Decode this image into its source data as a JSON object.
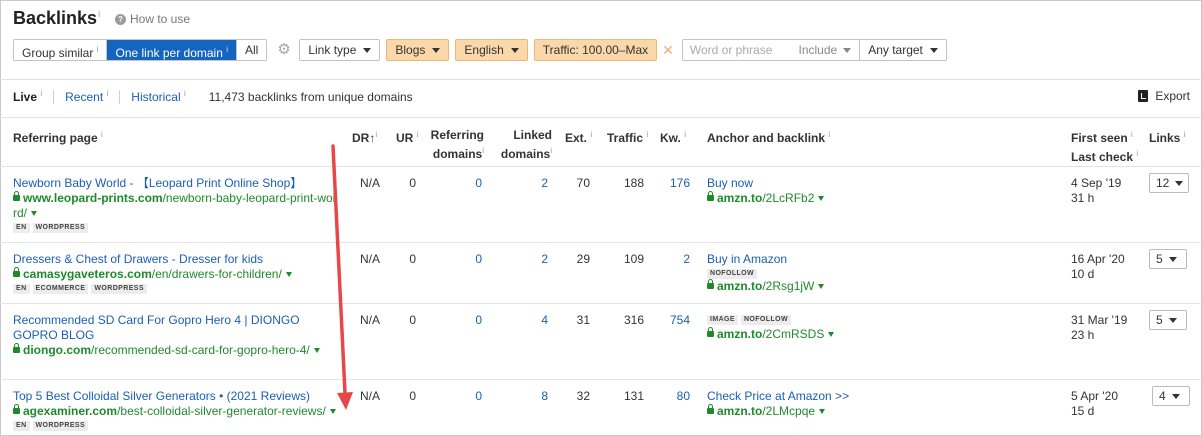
{
  "header": {
    "title": "Backlinks",
    "title_info": "i",
    "how_to_use": "How to use"
  },
  "toolbar": {
    "group_similar": "Group similar",
    "one_link_per_domain": "One link per domain",
    "all": "All",
    "info": "i",
    "link_type": "Link type",
    "blogs": "Blogs",
    "language": "English",
    "traffic": "Traffic: 100.00–Max",
    "search_placeholder": "Word or phrase",
    "include": "Include",
    "any_target": "Any target"
  },
  "tabs": {
    "live": "Live",
    "recent": "Recent",
    "historical": "Historical",
    "info": "i",
    "count": "11,473 backlinks from unique domains",
    "export": "Export"
  },
  "columns": {
    "referring_page": "Referring page",
    "dr": "DR",
    "dr_sort": "↑",
    "ur": "UR",
    "ref_domains_1": "Referring",
    "ref_domains_2": "domains",
    "linked_domains_1": "Linked",
    "linked_domains_2": "domains",
    "ext": "Ext.",
    "traffic": "Traffic",
    "kw": "Kw.",
    "anchor": "Anchor and backlink",
    "first_seen": "First seen",
    "last_check": "Last check",
    "links": "Links",
    "info": "i"
  },
  "rows": [
    {
      "title": "Newborn Baby World - 【Leopard Print Online Shop】",
      "domain": "www.leopard-prints.com",
      "path": "/newborn-baby-leopard-print-wol",
      "path2": "rd/",
      "tags": [
        "EN",
        "WORDPRESS"
      ],
      "dr": "N/A",
      "ur": "0",
      "ref_domains": "0",
      "linked_domains": "2",
      "ext": "70",
      "traffic": "188",
      "kw": "176",
      "anchor": "Buy now",
      "anchor_tags": [],
      "backlink_domain": "amzn.to",
      "backlink_path": "/2LcRFb2",
      "first_seen": "4 Sep '19",
      "last_check": "31 h",
      "links": "12"
    },
    {
      "title": "Dressers & Chest of Drawers - Dresser for kids",
      "domain": "camasygaveteros.com",
      "path": "/en/drawers-for-children/",
      "path2": "",
      "tags": [
        "EN",
        "ECOMMERCE",
        "WORDPRESS"
      ],
      "dr": "N/A",
      "ur": "0",
      "ref_domains": "0",
      "linked_domains": "2",
      "ext": "29",
      "traffic": "109",
      "kw": "2",
      "anchor": "Buy in Amazon",
      "anchor_tags": [
        "NOFOLLOW"
      ],
      "backlink_domain": "amzn.to",
      "backlink_path": "/2Rsg1jW",
      "first_seen": "16 Apr '20",
      "last_check": "10 d",
      "links": "5"
    },
    {
      "title": "Recommended SD Card For Gopro Hero 4 | DIONGO",
      "title2": "GOPRO BLOG",
      "domain": "diongo.com",
      "path": "/recommended-sd-card-for-gopro-hero-4/",
      "path2": "",
      "tags": [],
      "dr": "N/A",
      "ur": "0",
      "ref_domains": "0",
      "linked_domains": "4",
      "ext": "31",
      "traffic": "316",
      "kw": "754",
      "anchor": "",
      "anchor_tags": [
        "IMAGE",
        "NOFOLLOW"
      ],
      "backlink_domain": "amzn.to",
      "backlink_path": "/2CmRSDS",
      "first_seen": "31 Mar '19",
      "last_check": "23 h",
      "links": "5"
    },
    {
      "title": "Top 5 Best Colloidal Silver Generators • (2021 Reviews)",
      "domain": "agexaminer.com",
      "path": "/best-colloidal-silver-generator-reviews/",
      "path2": "",
      "tags": [
        "EN",
        "WORDPRESS"
      ],
      "dr": "N/A",
      "ur": "0",
      "ref_domains": "0",
      "linked_domains": "8",
      "ext": "32",
      "traffic": "131",
      "kw": "80",
      "anchor": "Check Price at Amazon >>",
      "anchor_tags": [],
      "backlink_domain": "amzn.to",
      "backlink_path": "/2LMcpqe",
      "first_seen": "5 Apr '20",
      "last_check": "15 d",
      "links": "4"
    }
  ],
  "colors": {
    "accent": "#1565c0",
    "link": "#1a5fb4",
    "url_green": "#1f8a2c",
    "filter_tan": "#fbd8a9",
    "annotation_arrow": "#e8474a"
  }
}
